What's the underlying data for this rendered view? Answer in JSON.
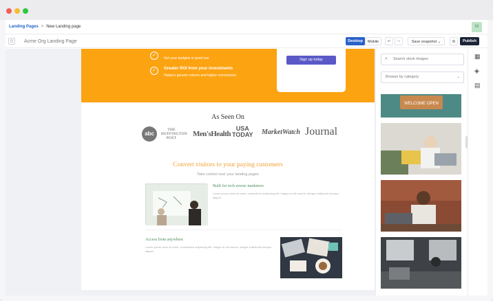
{
  "breadcrumb": {
    "root": "Landing Pages",
    "separator": ">",
    "current": "New Landing page"
  },
  "avatar": {
    "initial": "M"
  },
  "toolbar": {
    "page_icon": "▢",
    "page_name": "Acme Org Landing Page",
    "desktop": "Desktop",
    "mobile": "Mobile",
    "undo": "↶",
    "redo": "↷",
    "save_snapshot": "Save snapshot",
    "settings": "⚙",
    "publish": "Publish"
  },
  "page": {
    "line1": "Get your budgets in good use",
    "feature_title": "Greater ROI from your investments",
    "feature_text": "Helpers generic returns and higher conversions",
    "signup": "Sign up today",
    "as_seen_on": "As Seen On",
    "logos": {
      "abc": "abc",
      "huffington": "THE HUFFINGTON POST",
      "menshealth": "Men'sHealth",
      "usa_top": "USA",
      "usa_bottom": "TODAY",
      "marketwatch": "MarketWatch",
      "journal": "Journal"
    },
    "convert_title": "Convert visitors to your paying customers",
    "convert_sub": "Take control over your landing pages",
    "feature1_title": "Built for tech averse marketers",
    "feature1_text": "Lorem ipsum dolor sit amet, consectetur adipiscing elit. Integer et elit mauris. Integer sollicitudin tempus aliquet.",
    "feature2_title": "Access from anywhere",
    "feature2_text": "Lorem ipsum dolor sit amet, consectetur adipiscing elit. Integer et elit mauris. Integer sollicitudin tempus aliquet."
  },
  "sidepanel": {
    "search_placeholder": "Search stock images",
    "browse": "Browse by category",
    "stock_sign": "WELCOME OPEN"
  },
  "icons": {
    "search": "⌕",
    "chevron": "⌄",
    "check": "✓",
    "grid": "▦",
    "layers": "◈",
    "layout": "▤"
  }
}
